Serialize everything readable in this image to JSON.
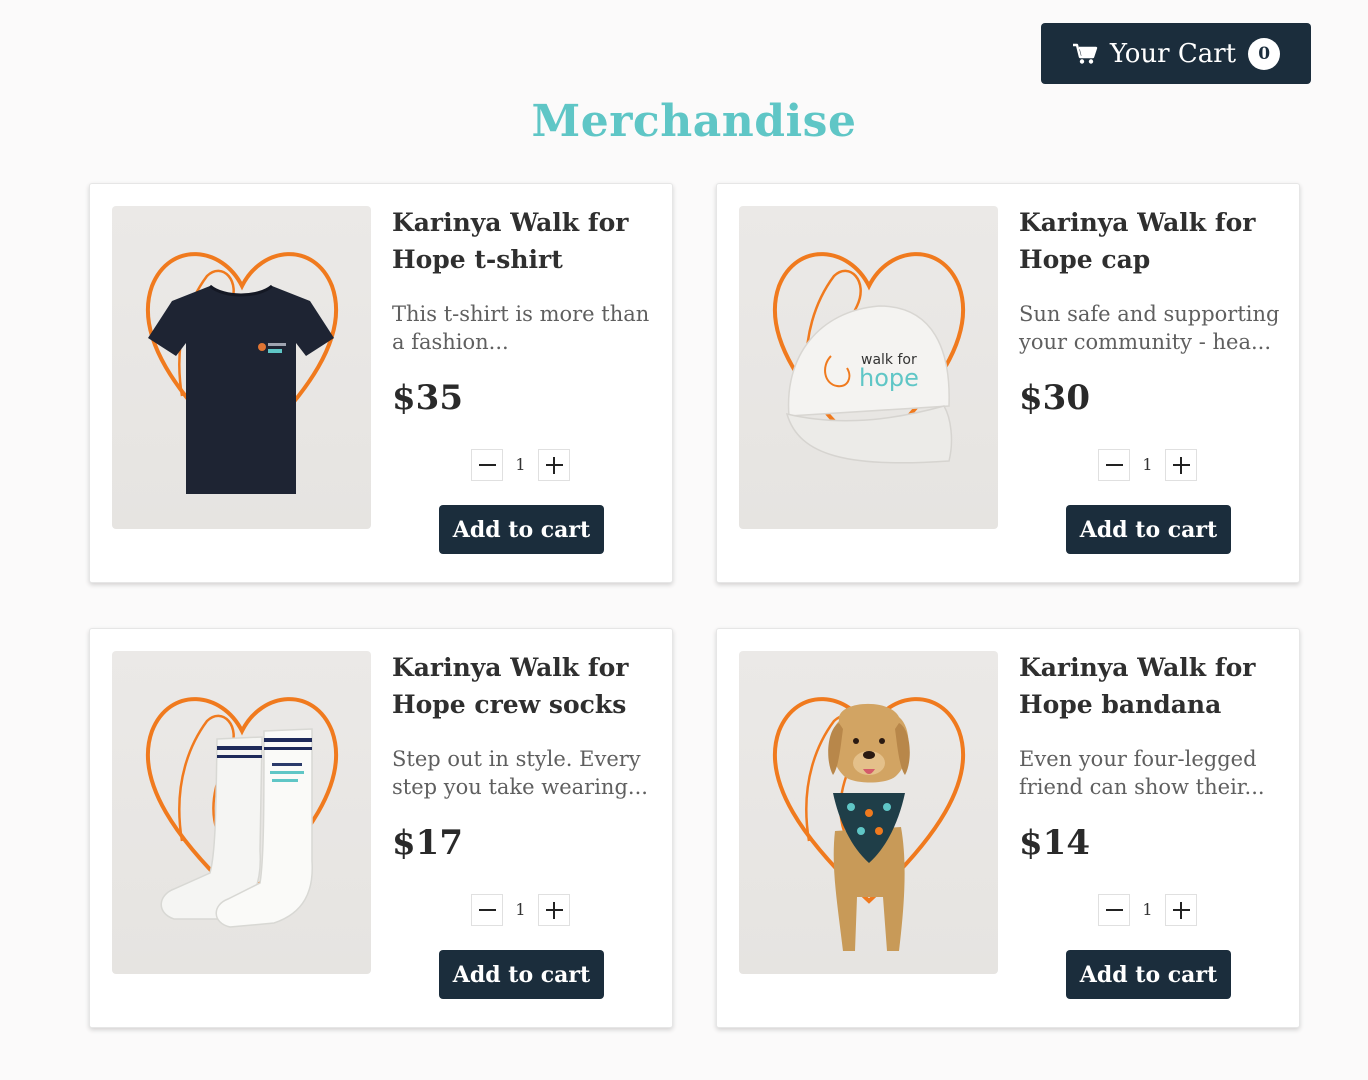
{
  "header": {
    "cart_label": "Your Cart",
    "cart_count": "0"
  },
  "page_title": "Merchandise",
  "colors": {
    "accent": "#5fc6c6",
    "button": "#1b2d3c",
    "heart_orange": "#f07a1e"
  },
  "products": [
    {
      "name": "Karinya Walk for Hope t-shirt",
      "description": "This t-shirt is more than a fashion...",
      "price": "$35",
      "quantity": "1",
      "add_label": "Add to cart",
      "image_icon": "tshirt-image"
    },
    {
      "name": "Karinya Walk for Hope cap",
      "description": "Sun safe and supporting your community - hea...",
      "price": "$30",
      "quantity": "1",
      "add_label": "Add to cart",
      "image_icon": "cap-image",
      "image_text": [
        "walk for",
        "hope"
      ]
    },
    {
      "name": "Karinya Walk for Hope crew socks",
      "description": "Step out in style. Every step you take wearing...",
      "price": "$17",
      "quantity": "1",
      "add_label": "Add to cart",
      "image_icon": "socks-image"
    },
    {
      "name": "Karinya Walk for Hope bandana",
      "description": "Even your four-legged friend can show their...",
      "price": "$14",
      "quantity": "1",
      "add_label": "Add to cart",
      "image_icon": "dog-bandana-image"
    }
  ]
}
